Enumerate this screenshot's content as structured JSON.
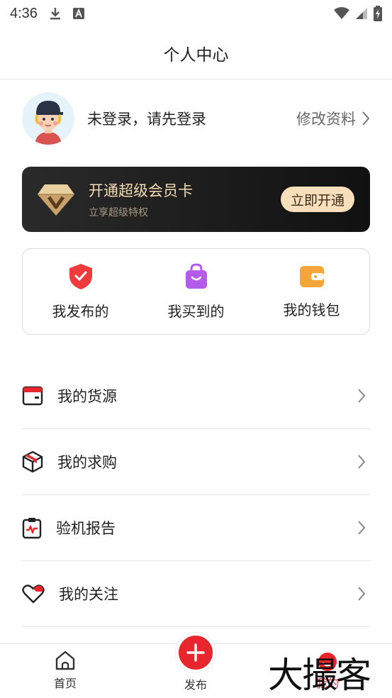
{
  "status_bar": {
    "time": "4:36"
  },
  "header": {
    "title": "个人中心"
  },
  "profile": {
    "login_text": "未登录，请先登录",
    "edit_label": "修改资料"
  },
  "vip": {
    "title": "开通超级会员卡",
    "subtitle": "立享超级特权",
    "button": "立即开通"
  },
  "quick_actions": [
    {
      "label": "我发布的",
      "icon": "red-shield-check-icon"
    },
    {
      "label": "我买到的",
      "icon": "purple-shopping-bag-icon"
    },
    {
      "label": "我的钱包",
      "icon": "orange-wallet-icon"
    }
  ],
  "menu": [
    {
      "label": "我的货源",
      "icon": "card-icon"
    },
    {
      "label": "我的求购",
      "icon": "box-icon"
    },
    {
      "label": "验机报告",
      "icon": "clipboard-report-icon"
    },
    {
      "label": "我的关注",
      "icon": "heart-icon"
    }
  ],
  "tabbar": {
    "home": "首页",
    "publish": "发布",
    "mine": "我的"
  },
  "watermark": "大撮客",
  "colors": {
    "accent": "#e8262d",
    "vip_gold": "#f4dcb3"
  }
}
